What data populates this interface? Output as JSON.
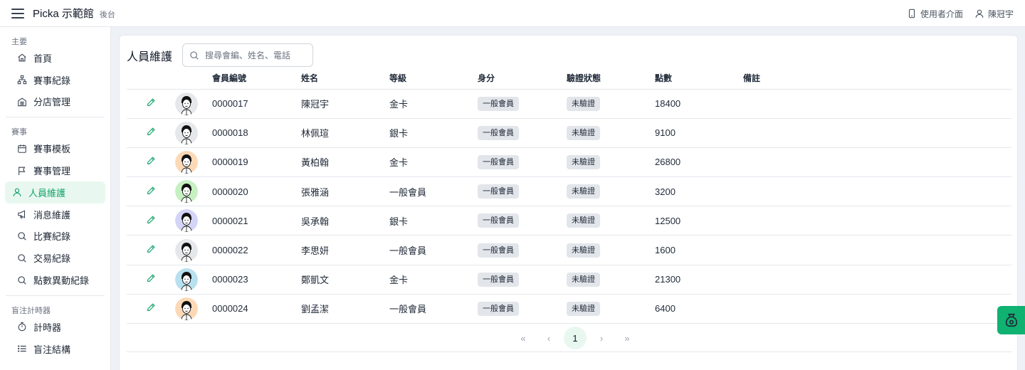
{
  "header": {
    "brand": "Picka 示範館",
    "brand_sub": "後台",
    "user_interface_label": "使用者介面",
    "user_name": "陳冠宇"
  },
  "sidebar": {
    "sections": [
      {
        "title": "主要",
        "items": [
          {
            "label": "首頁",
            "icon": "home-icon"
          },
          {
            "label": "賽事紀錄",
            "icon": "hierarchy-icon"
          },
          {
            "label": "分店管理",
            "icon": "building-icon"
          }
        ]
      },
      {
        "title": "賽事",
        "items": [
          {
            "label": "賽事模板",
            "icon": "calendar-icon"
          },
          {
            "label": "賽事管理",
            "icon": "flag-icon"
          },
          {
            "label": "人員維護",
            "icon": "user-icon",
            "active": true
          },
          {
            "label": "消息維護",
            "icon": "megaphone-icon"
          },
          {
            "label": "比賽紀錄",
            "icon": "search-icon"
          },
          {
            "label": "交易紀錄",
            "icon": "search-icon"
          },
          {
            "label": "點數異動紀錄",
            "icon": "search-icon"
          }
        ]
      },
      {
        "title": "盲注計時器",
        "items": [
          {
            "label": "計時器",
            "icon": "stopwatch-icon"
          },
          {
            "label": "盲注結構",
            "icon": "list-icon"
          }
        ]
      }
    ]
  },
  "main": {
    "title": "人員維護",
    "search_placeholder": "搜尋會編、姓名、電話",
    "columns": [
      "",
      "",
      "會員編號",
      "姓名",
      "等級",
      "身分",
      "驗證狀態",
      "點數",
      "備註"
    ],
    "rows": [
      {
        "id": "0000017",
        "name": "陳冠宇",
        "level": "金卡",
        "role": "一般會員",
        "verify": "未驗證",
        "points": "18400",
        "note": "",
        "avatar_bg": "#e5e7eb"
      },
      {
        "id": "0000018",
        "name": "林佩瑄",
        "level": "銀卡",
        "role": "一般會員",
        "verify": "未驗證",
        "points": "9100",
        "note": "",
        "avatar_bg": "#e5e7eb"
      },
      {
        "id": "0000019",
        "name": "黃柏翰",
        "level": "金卡",
        "role": "一般會員",
        "verify": "未驗證",
        "points": "26800",
        "note": "",
        "avatar_bg": "#fcd9b6"
      },
      {
        "id": "0000020",
        "name": "張雅涵",
        "level": "一般會員",
        "role": "一般會員",
        "verify": "未驗證",
        "points": "3200",
        "note": "",
        "avatar_bg": "#c6f0c2"
      },
      {
        "id": "0000021",
        "name": "吳承翰",
        "level": "銀卡",
        "role": "一般會員",
        "verify": "未驗證",
        "points": "12500",
        "note": "",
        "avatar_bg": "#d4d4f7"
      },
      {
        "id": "0000022",
        "name": "李思妍",
        "level": "一般會員",
        "role": "一般會員",
        "verify": "未驗證",
        "points": "1600",
        "note": "",
        "avatar_bg": "#e5e7eb"
      },
      {
        "id": "0000023",
        "name": "鄭凱文",
        "level": "金卡",
        "role": "一般會員",
        "verify": "未驗證",
        "points": "21300",
        "note": "",
        "avatar_bg": "#b8e0ef"
      },
      {
        "id": "0000024",
        "name": "劉孟潔",
        "level": "一般會員",
        "role": "一般會員",
        "verify": "未驗證",
        "points": "6400",
        "note": "",
        "avatar_bg": "#fcd9b6"
      }
    ],
    "pagination": {
      "first": "«",
      "prev": "‹",
      "current": "1",
      "next": "›",
      "last": "»"
    }
  },
  "colors": {
    "accent": "#16a36a",
    "active_bg": "#e8f8f0",
    "float_button": "#10b272",
    "tag_bg": "#e2e5ea"
  }
}
